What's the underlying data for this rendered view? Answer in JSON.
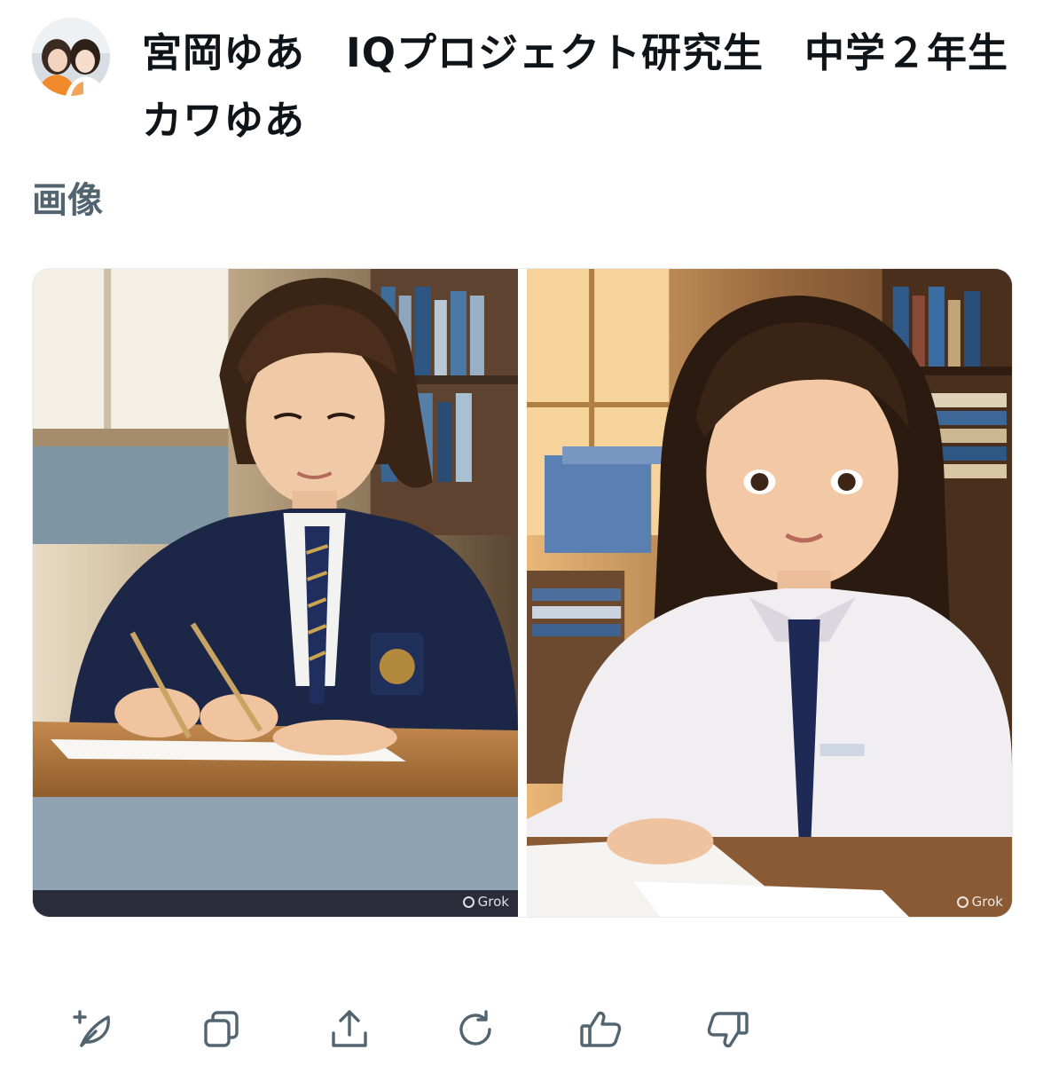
{
  "post": {
    "prompt_text": "宮岡ゆあ　IQプロジェクト研究生　中学２年生　カワゆあ",
    "section_label": "画像"
  },
  "gallery": {
    "images": [
      {
        "icon": "generated-image-student-writing",
        "watermark": "Grok"
      },
      {
        "icon": "generated-image-student-illustration",
        "watermark": "Grok"
      }
    ]
  },
  "actions": [
    {
      "icon": "edit-quill-icon"
    },
    {
      "icon": "copy-icon"
    },
    {
      "icon": "share-icon"
    },
    {
      "icon": "regenerate-icon"
    },
    {
      "icon": "thumbs-up-icon"
    },
    {
      "icon": "thumbs-down-icon"
    }
  ],
  "colors": {
    "text_primary": "#0f1419",
    "text_secondary": "#536471",
    "icon": "#536471"
  }
}
